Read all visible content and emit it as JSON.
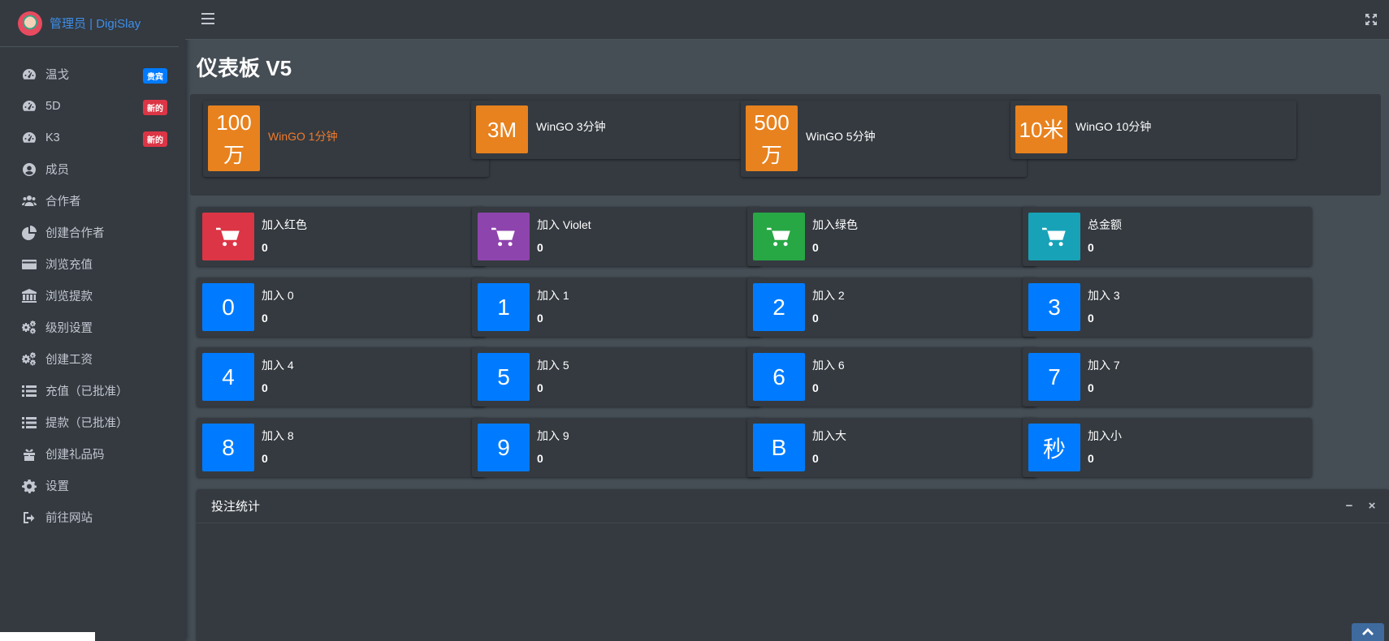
{
  "brand": {
    "title": "管理员 | DigiSlay"
  },
  "sidebar": {
    "items": [
      {
        "label": "温戈",
        "icon": "tachometer-icon",
        "badge": "贵宾",
        "badge_color": "#007bff"
      },
      {
        "label": "5D",
        "icon": "tachometer-icon",
        "badge": "新的",
        "badge_color": "#dc3545"
      },
      {
        "label": "K3",
        "icon": "tachometer-icon",
        "badge": "新的",
        "badge_color": "#dc3545"
      },
      {
        "label": "成员",
        "icon": "user-circle-icon"
      },
      {
        "label": "合作者",
        "icon": "users-icon"
      },
      {
        "label": "创建合作者",
        "icon": "pie-chart-icon"
      },
      {
        "label": "浏览充值",
        "icon": "credit-card-icon"
      },
      {
        "label": "浏览提款",
        "icon": "bank-icon"
      },
      {
        "label": "级别设置",
        "icon": "cogs-icon"
      },
      {
        "label": "创建工资",
        "icon": "cogs-icon"
      },
      {
        "label": "充值（已批准）",
        "icon": "list-icon"
      },
      {
        "label": "提款（已批准）",
        "icon": "list-icon"
      },
      {
        "label": "创建礼品码",
        "icon": "gift-icon"
      },
      {
        "label": "设置",
        "icon": "gear-icon"
      },
      {
        "label": "前往网站",
        "icon": "sign-out-icon"
      }
    ]
  },
  "page": {
    "title": "仪表板 V5"
  },
  "game_cards": [
    {
      "icon_text": "100万",
      "label": "WinGO 1分钟",
      "active": true
    },
    {
      "icon_text": "3M",
      "label": "WinGO 3分钟"
    },
    {
      "icon_text": "500万",
      "label": "WinGO 5分钟"
    },
    {
      "icon_text": "10米",
      "label": "WinGO 10分钟"
    }
  ],
  "stats": [
    {
      "icon": "cart-icon",
      "label": "加入红色",
      "value": "0",
      "color": "#dc3545"
    },
    {
      "icon": "cart-icon",
      "label": "加入 Violet",
      "value": "0",
      "color": "#8e44ad"
    },
    {
      "icon": "cart-icon",
      "label": "加入绿色",
      "value": "0",
      "color": "#28a745"
    },
    {
      "icon": "cart-icon",
      "label": "总金额",
      "value": "0",
      "color": "#17a2b8"
    },
    {
      "icon_text": "0",
      "label": "加入 0",
      "value": "0"
    },
    {
      "icon_text": "1",
      "label": "加入 1",
      "value": "0"
    },
    {
      "icon_text": "2",
      "label": "加入 2",
      "value": "0"
    },
    {
      "icon_text": "3",
      "label": "加入 3",
      "value": "0"
    },
    {
      "icon_text": "4",
      "label": "加入 4",
      "value": "0"
    },
    {
      "icon_text": "5",
      "label": "加入 5",
      "value": "0"
    },
    {
      "icon_text": "6",
      "label": "加入 6",
      "value": "0"
    },
    {
      "icon_text": "7",
      "label": "加入 7",
      "value": "0"
    },
    {
      "icon_text": "8",
      "label": "加入 8",
      "value": "0"
    },
    {
      "icon_text": "9",
      "label": "加入 9",
      "value": "0"
    },
    {
      "icon_text": "B",
      "label": "加入大",
      "value": "0"
    },
    {
      "icon_text": "秒",
      "label": "加入小",
      "value": "0"
    }
  ],
  "chart_card": {
    "title": "投注统计",
    "minimize": "−",
    "close": "×"
  }
}
